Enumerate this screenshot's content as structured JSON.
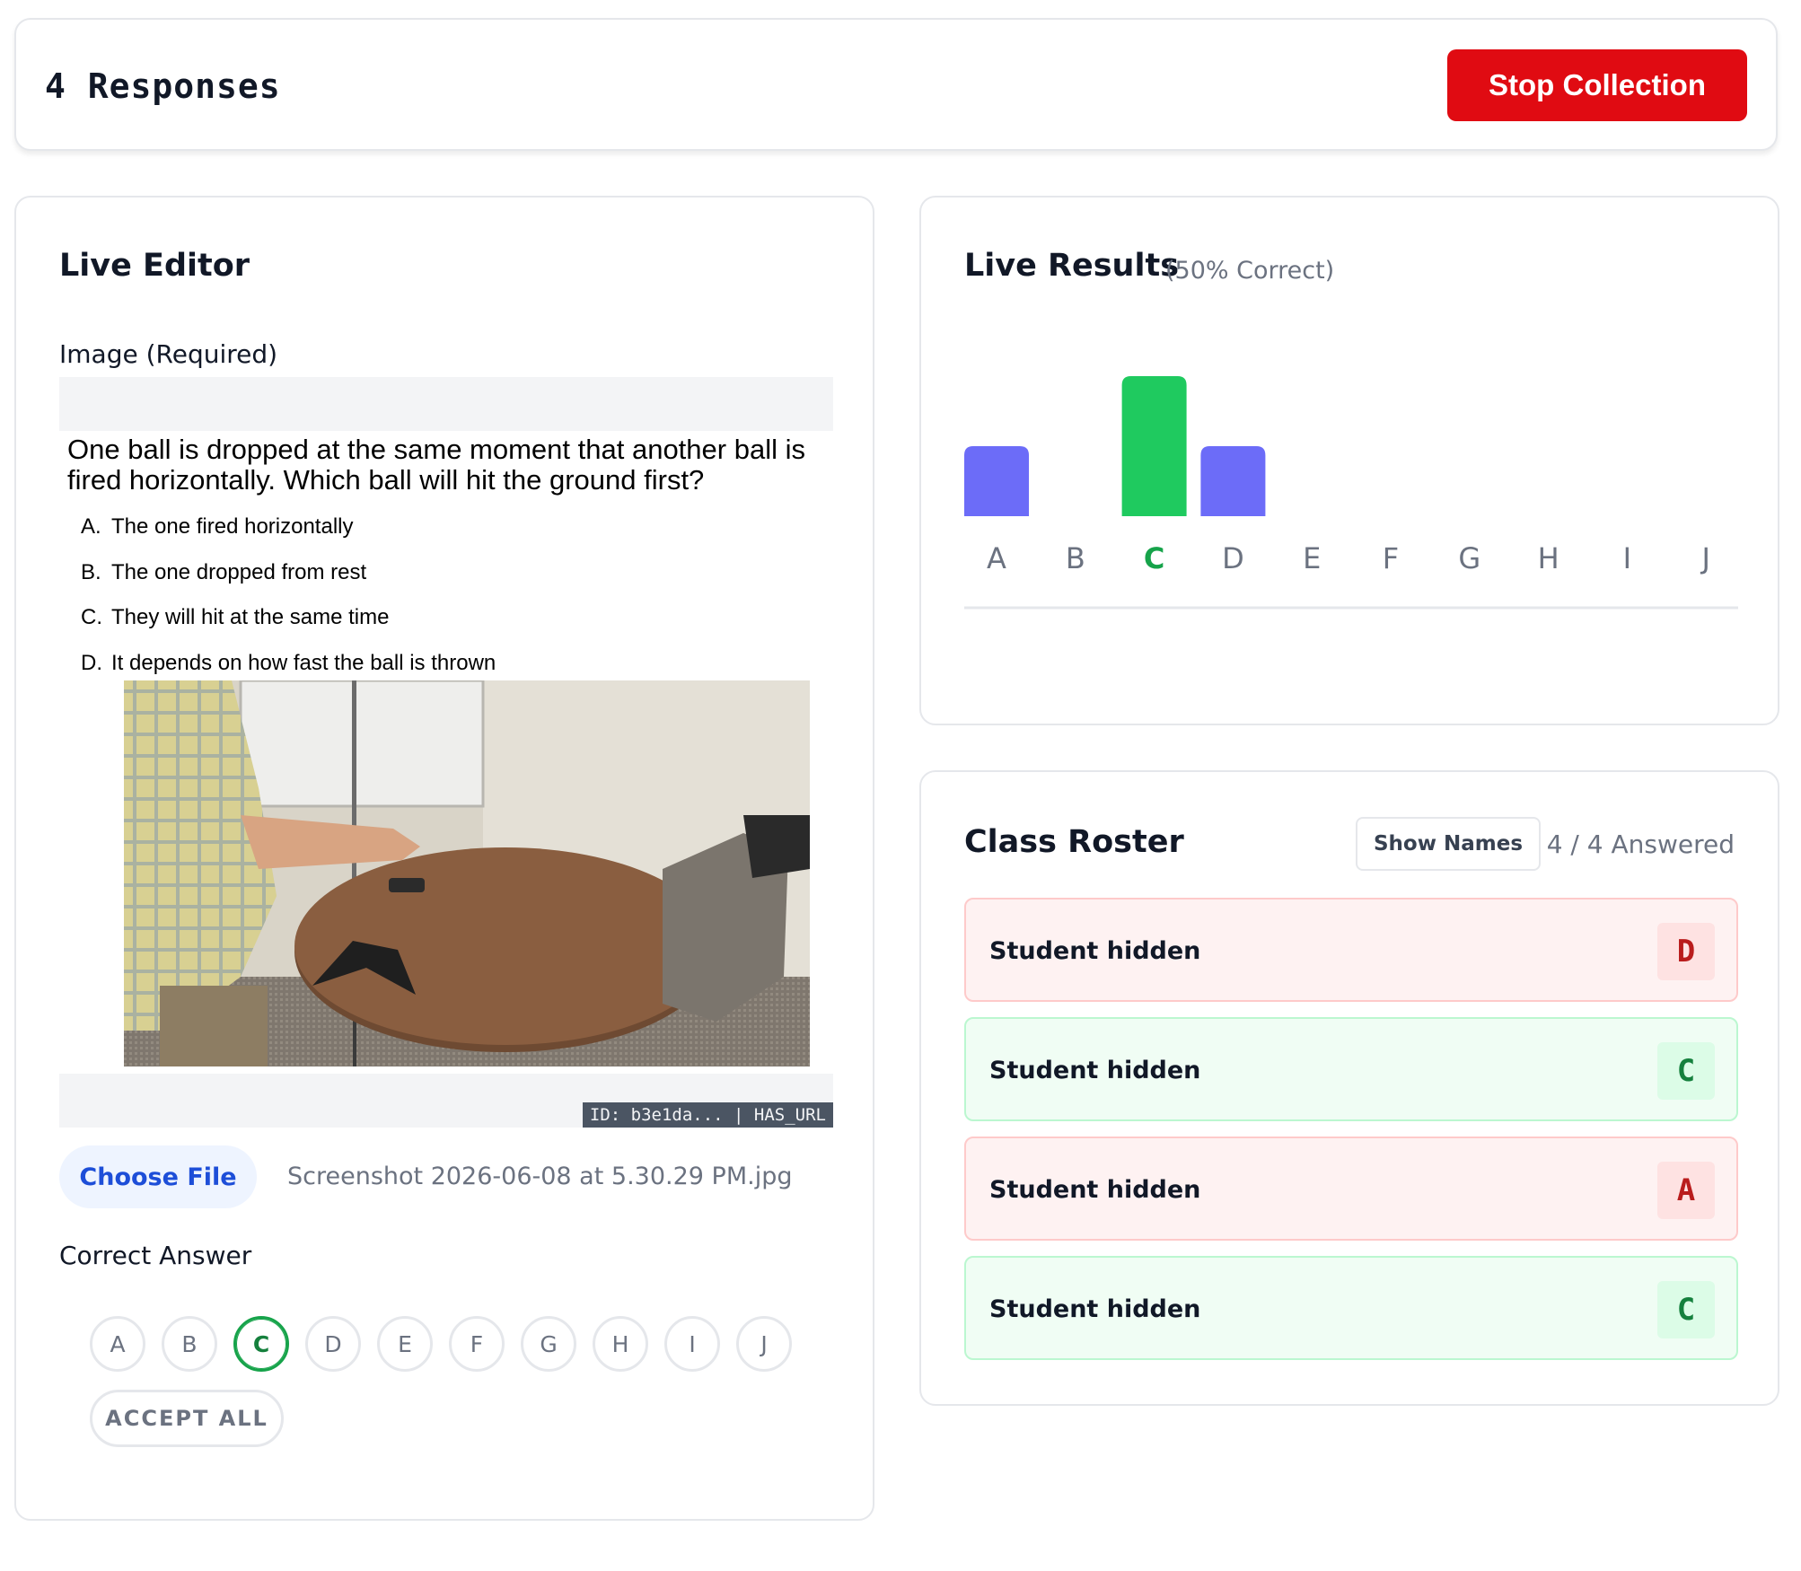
{
  "header": {
    "responses_label": "4  Responses",
    "stop_label": "Stop Collection"
  },
  "editor": {
    "title": "Live Editor",
    "image_label": "Image (Required)",
    "question": "One ball is dropped at the same moment that another ball is fired horizontally. Which ball will hit the ground first?",
    "options": [
      {
        "letter": "A.",
        "text": "The one fired horizontally"
      },
      {
        "letter": "B.",
        "text": "The one dropped from rest"
      },
      {
        "letter": "C.",
        "text": "They will hit at the same time"
      },
      {
        "letter": "D.",
        "text": "It depends on how fast the ball is thrown"
      }
    ],
    "id_badge": "ID: b3e1da... | HAS_URL",
    "choose_file_label": "Choose File",
    "file_name": "Screenshot 2026-06-08 at 5.30.29 PM.jpg",
    "correct_answer_label": "Correct Answer",
    "answer_choices": [
      "A",
      "B",
      "C",
      "D",
      "E",
      "F",
      "G",
      "H",
      "I",
      "J"
    ],
    "selected_answer": "C",
    "accept_all_label": "ACCEPT ALL"
  },
  "results": {
    "title": "Live Results",
    "subtitle": "(50% Correct)"
  },
  "chart_data": {
    "type": "bar",
    "categories": [
      "A",
      "B",
      "C",
      "D",
      "E",
      "F",
      "G",
      "H",
      "I",
      "J"
    ],
    "values": [
      1,
      0,
      2,
      1,
      0,
      0,
      0,
      0,
      0,
      0
    ],
    "correct_category": "C",
    "colors": {
      "default": "#6c6cf8",
      "correct": "#1fca5f",
      "label": "#6b7280",
      "correct_label": "#16a34a"
    },
    "ylim": [
      0,
      2
    ],
    "grid": false
  },
  "roster": {
    "title": "Class Roster",
    "show_names_label": "Show Names",
    "answered_label": "4 / 4 Answered",
    "students": [
      {
        "name": "Student hidden",
        "answer": "D",
        "status": "wrong"
      },
      {
        "name": "Student hidden",
        "answer": "C",
        "status": "right"
      },
      {
        "name": "Student hidden",
        "answer": "A",
        "status": "wrong"
      },
      {
        "name": "Student hidden",
        "answer": "C",
        "status": "right"
      }
    ]
  }
}
